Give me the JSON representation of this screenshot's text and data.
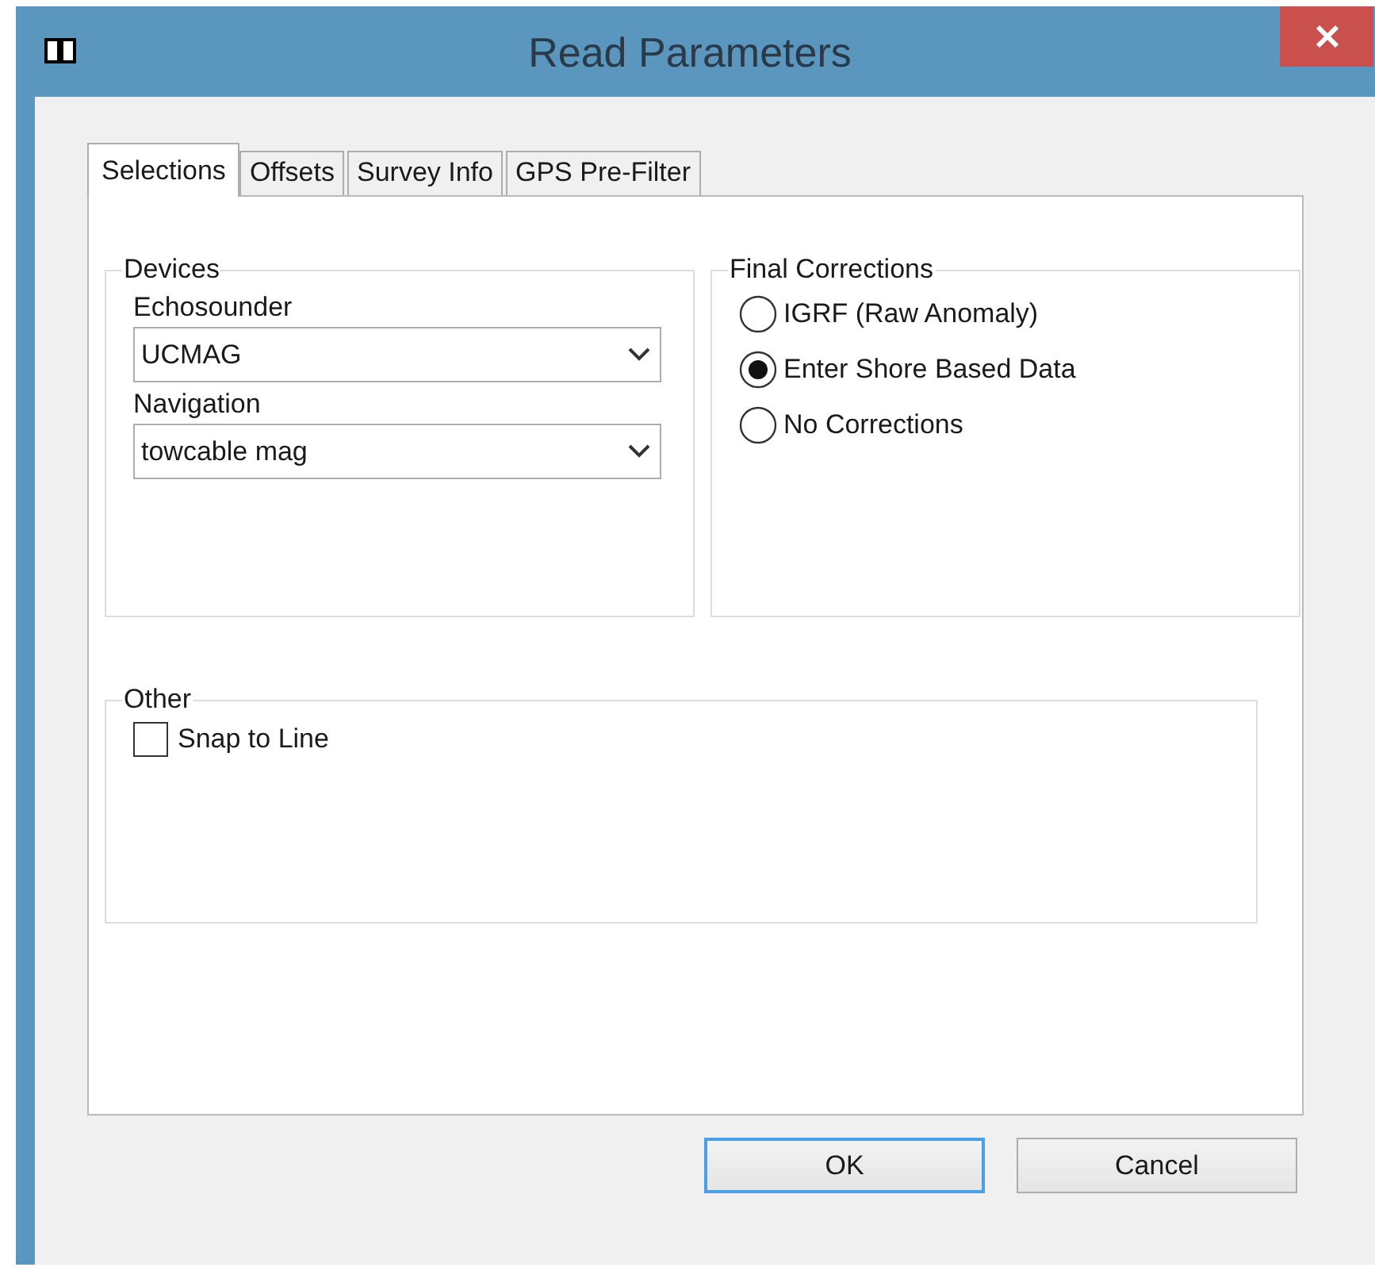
{
  "window": {
    "title": "Read Parameters"
  },
  "tabs": [
    {
      "label": "Selections",
      "selected": true
    },
    {
      "label": "Offsets",
      "selected": false
    },
    {
      "label": "Survey Info",
      "selected": false
    },
    {
      "label": "GPS Pre-Filter",
      "selected": false
    }
  ],
  "devices": {
    "legend": "Devices",
    "fields": [
      {
        "label": "Echosounder",
        "value": "UCMAG"
      },
      {
        "label": "Navigation",
        "value": "towcable mag"
      }
    ]
  },
  "final_corrections": {
    "legend": "Final Corrections",
    "options": [
      {
        "label": "IGRF (Raw Anomaly)",
        "selected": false
      },
      {
        "label": "Enter Shore Based Data",
        "selected": true
      },
      {
        "label": "No Corrections",
        "selected": false
      }
    ]
  },
  "other": {
    "legend": "Other",
    "checkboxes": [
      {
        "label": "Snap to Line",
        "checked": false
      }
    ]
  },
  "buttons": [
    {
      "label": "OK",
      "default": true
    },
    {
      "label": "Cancel",
      "default": false
    }
  ]
}
